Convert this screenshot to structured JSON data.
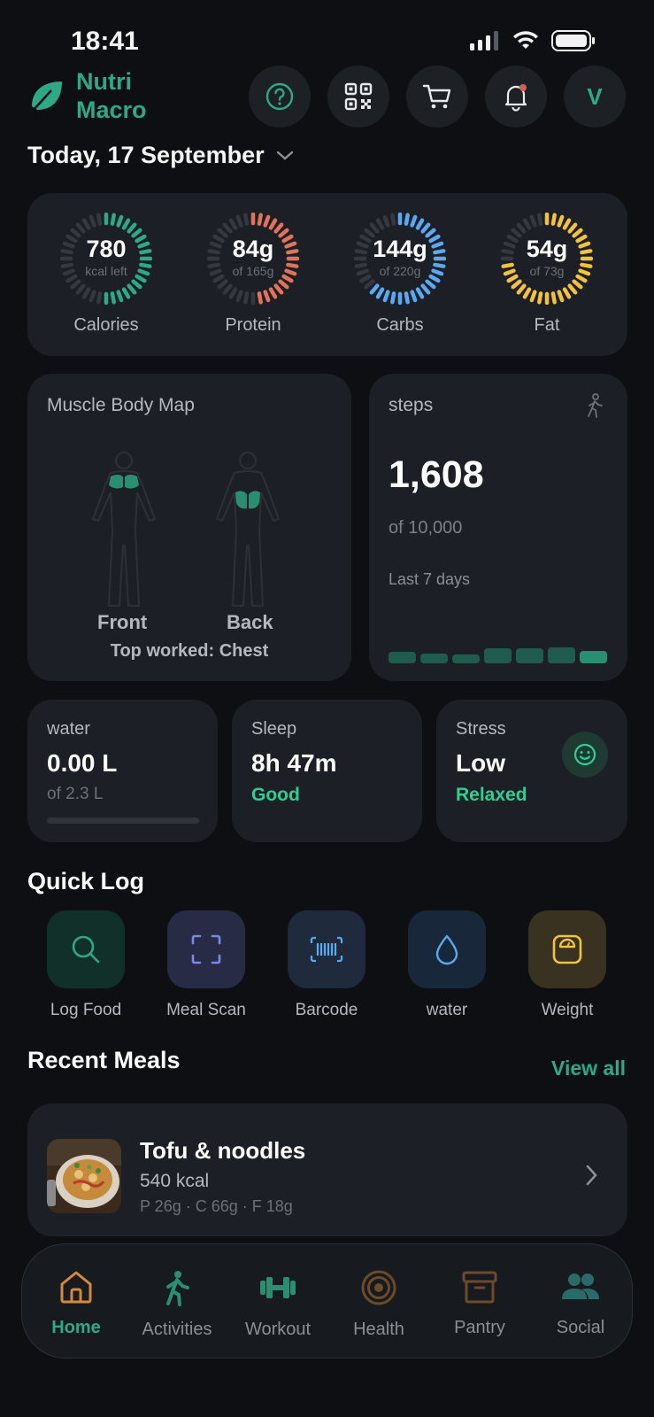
{
  "status_bar": {
    "time": "18:41"
  },
  "header": {
    "logo_line1": "Nutri",
    "logo_line2": "Macro",
    "avatar_letter": "V",
    "date": "Today, 17 September"
  },
  "macros": [
    {
      "value": "780",
      "sub": "kcal left",
      "label": "Calories",
      "color": "#2fa985",
      "progress": 0.53
    },
    {
      "value": "84g",
      "sub": "of 165g",
      "label": "Protein",
      "color": "#e2735a",
      "progress": 0.51
    },
    {
      "value": "144g",
      "sub": "of 220g",
      "label": "Carbs",
      "color": "#5aa9f0",
      "progress": 0.65
    },
    {
      "value": "54g",
      "sub": "of 73g",
      "label": "Fat",
      "color": "#f2c23e",
      "progress": 0.74
    }
  ],
  "muscle_map": {
    "title": "Muscle Body Map",
    "front_label": "Front",
    "back_label": "Back",
    "top_worked": "Top worked: Chest"
  },
  "steps": {
    "title": "steps",
    "value": "1,608",
    "goal": "of 10,000",
    "period": "Last 7 days",
    "week_levels": [
      0.55,
      0.45,
      0.4,
      0.7,
      0.7,
      0.75,
      0.6
    ]
  },
  "water": {
    "label": "water",
    "value": "0.00 L",
    "goal": "of 2.3 L",
    "progress": 0
  },
  "sleep": {
    "label": "Sleep",
    "value": "8h 47m",
    "status": "Good"
  },
  "stress": {
    "label": "Stress",
    "value": "Low",
    "status": "Relaxed"
  },
  "quick_log": {
    "title": "Quick Log",
    "items": [
      {
        "label": "Log Food",
        "icon": "search-icon",
        "bg": "#12302a"
      },
      {
        "label": "Meal Scan",
        "icon": "scan-icon",
        "bg": "#272b45"
      },
      {
        "label": "Barcode",
        "icon": "barcode-icon",
        "bg": "#1f2b3d"
      },
      {
        "label": "water",
        "icon": "water-drop-icon",
        "bg": "#18273a"
      },
      {
        "label": "Weight",
        "icon": "scale-icon",
        "bg": "#3a3220"
      }
    ]
  },
  "recent_meals": {
    "title": "Recent Meals",
    "view_all": "View all",
    "items": [
      {
        "name": "Tofu & noodles",
        "kcal": "540 kcal",
        "macros": "P 26g · C 66g · F 18g"
      }
    ]
  },
  "nav": {
    "items": [
      {
        "label": "Home",
        "icon": "home-icon",
        "active": true
      },
      {
        "label": "Activities",
        "icon": "walking-icon",
        "active": false
      },
      {
        "label": "Workout",
        "icon": "dumbbell-icon",
        "active": false
      },
      {
        "label": "Health",
        "icon": "target-icon",
        "active": false
      },
      {
        "label": "Pantry",
        "icon": "box-icon",
        "active": false
      },
      {
        "label": "Social",
        "icon": "people-icon",
        "active": false
      }
    ]
  }
}
